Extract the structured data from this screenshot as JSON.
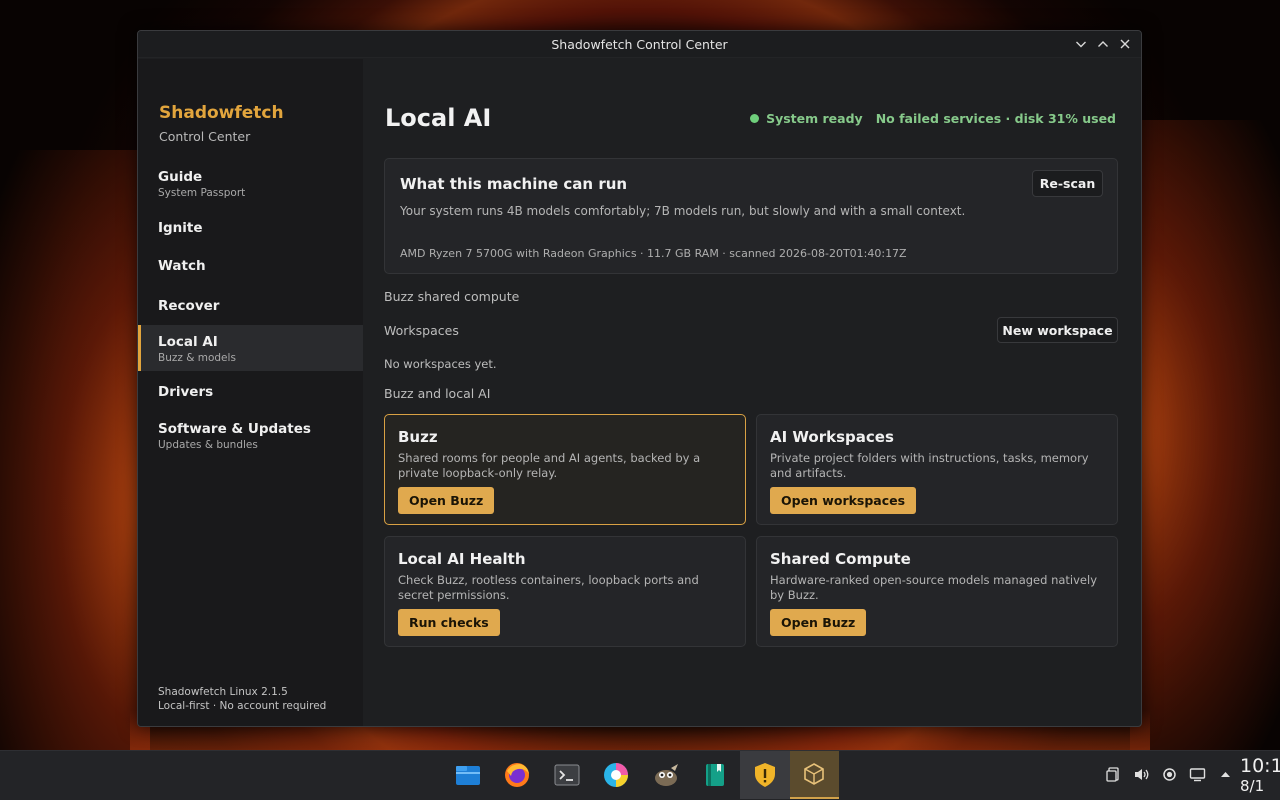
{
  "window": {
    "title": "Shadowfetch Control Center"
  },
  "sidebar": {
    "brand_name": "Shadowfetch",
    "brand_sub": "Control Center",
    "items": [
      {
        "label": "Guide",
        "sub": "System Passport"
      },
      {
        "label": "Ignite",
        "sub": ""
      },
      {
        "label": "Watch",
        "sub": ""
      },
      {
        "label": "Recover",
        "sub": ""
      },
      {
        "label": "Local AI",
        "sub": "Buzz & models"
      },
      {
        "label": "Drivers",
        "sub": ""
      },
      {
        "label": "Software & Updates",
        "sub": "Updates & bundles"
      }
    ],
    "footer_line1": "Shadowfetch Linux 2.1.5",
    "footer_line2": "Local-first · No account required"
  },
  "main": {
    "title": "Local AI",
    "status_ready": "System ready",
    "status_services": "No failed services · disk 31% used",
    "capability": {
      "title": "What this machine can run",
      "description": "Your system runs 4B models comfortably; 7B models run, but slowly and with a small context.",
      "meta": "AMD Ryzen 7 5700G with Radeon Graphics · 11.7 GB RAM · scanned 2026-08-20T01:40:17Z",
      "rescan_label": "Re-scan"
    },
    "shared_compute_label": "Buzz shared compute",
    "workspaces_label": "Workspaces",
    "new_workspace_label": "New workspace",
    "empty_workspaces": "No workspaces yet.",
    "buzz_section_label": "Buzz and local AI",
    "cards": [
      {
        "title": "Buzz",
        "description": "Shared rooms for people and AI agents, backed by a private loopback-only relay.",
        "button": "Open Buzz"
      },
      {
        "title": "AI Workspaces",
        "description": "Private project folders with instructions, tasks, memory and artifacts.",
        "button": "Open workspaces"
      },
      {
        "title": "Local AI Health",
        "description": "Check Buzz, rootless containers, loopback ports and secret permissions.",
        "button": "Run checks"
      },
      {
        "title": "Shared Compute",
        "description": "Hardware-ranked open-source models managed natively by Buzz.",
        "button": "Open Buzz"
      }
    ]
  },
  "taskbar": {
    "apps": [
      "file-manager-icon",
      "firefox-icon",
      "terminal-icon",
      "color-picker-icon",
      "gimp-icon",
      "notes-icon",
      "shield-warning-icon",
      "package-icon"
    ],
    "clock_time": "10:1",
    "clock_date": "8/1"
  },
  "colors": {
    "accent": "#e2a53d",
    "status_green": "#86c98a",
    "button_gold": "#e0a94e"
  }
}
